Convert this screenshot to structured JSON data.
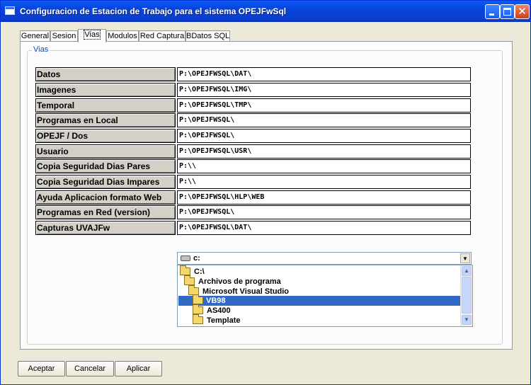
{
  "window": {
    "title": "Configuracion de Estacion de Trabajo para el sistema OPEJFwSql",
    "close_glyph": "✕"
  },
  "tabs": [
    {
      "label": "General"
    },
    {
      "label": "Sesion"
    },
    {
      "label": "Vias"
    },
    {
      "label": "Modulos"
    },
    {
      "label": "Red Captura"
    },
    {
      "label": "BDatos SQL"
    }
  ],
  "active_tab": "Vias",
  "group": {
    "caption": "Vias"
  },
  "paths": [
    {
      "label": "Datos",
      "value": "P:\\OPEJFWSQL\\DAT\\"
    },
    {
      "label": "Imagenes",
      "value": "P:\\OPEJFWSQL\\IMG\\"
    },
    {
      "label": "Temporal",
      "value": "P:\\OPEJFWSQL\\TMP\\"
    },
    {
      "label": "Programas en Local",
      "value": "P:\\OPEJFWSQL\\"
    },
    {
      "label": "OPEJF / Dos",
      "value": "P:\\OPEJFWSQL\\"
    },
    {
      "label": "Usuario",
      "value": "P:\\OPEJFWSQL\\USR\\"
    },
    {
      "label": "Copia Seguridad Dias Pares",
      "value": "P:\\\\"
    },
    {
      "label": "Copia Seguridad Dias Impares",
      "value": "P:\\\\"
    },
    {
      "label": "Ayuda Aplicacion formato Web",
      "value": "P:\\OPEJFWSQL\\HLP\\WEB"
    },
    {
      "label": "Programas en Red (version)",
      "value": "P:\\OPEJFWSQL\\"
    },
    {
      "label": "Capturas UVAJFw",
      "value": "P:\\OPEJFWSQL\\DAT\\"
    }
  ],
  "drive": {
    "value": "c:",
    "arrow": "▼"
  },
  "directories": [
    {
      "name": "C:\\",
      "selected": false
    },
    {
      "name": "Archivos de programa",
      "selected": false
    },
    {
      "name": "Microsoft Visual Studio",
      "selected": false
    },
    {
      "name": "VB98",
      "selected": true
    },
    {
      "name": "AS400",
      "selected": false
    },
    {
      "name": "Template",
      "selected": false
    }
  ],
  "scrollbar": {
    "up": "▲",
    "down": "▼"
  },
  "buttons": {
    "accept": "Aceptar",
    "cancel": "Cancelar",
    "apply": "Aplicar"
  }
}
